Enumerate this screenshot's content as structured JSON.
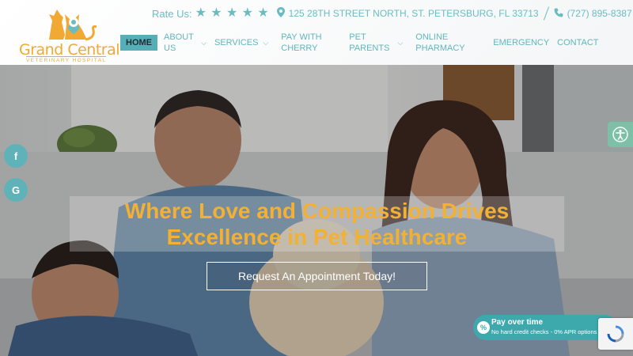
{
  "logo": {
    "name": "Grand Central",
    "subtitle": "VETERINARY HOSPITAL"
  },
  "topbar": {
    "rate_label": "Rate Us:",
    "stars": 5,
    "address": "125 28TH STREET NORTH, ST. PETERSBURG, FL 33713",
    "phone": "(727) 895-8387"
  },
  "nav": {
    "home": "HOME",
    "about": "ABOUT US",
    "services": "SERVICES",
    "cherry": "PAY WITH CHERRY",
    "pet_parents": "PET PARENTS",
    "pharmacy": "ONLINE PHARMACY",
    "emergency": "EMERGENCY",
    "contact": "CONTACT"
  },
  "hero": {
    "headline_line1": "Where Love and Compassion Drives",
    "headline_line2": "Excellence in Pet Healthcare",
    "cta": "Request An Appointment Today!"
  },
  "social": {
    "facebook_glyph": "f",
    "google_glyph": "G"
  },
  "cherry_widget": {
    "title": "Pay over time",
    "subtitle": "No hard credit checks - 0% APR options",
    "icon_glyph": "%"
  },
  "colors": {
    "teal": "#5fb6bc",
    "gold": "#f2b134",
    "active_nav_bg": "#56aeb6",
    "cherry_bg": "#3da9ad",
    "accessibility_bg": "#7cc0a8"
  }
}
